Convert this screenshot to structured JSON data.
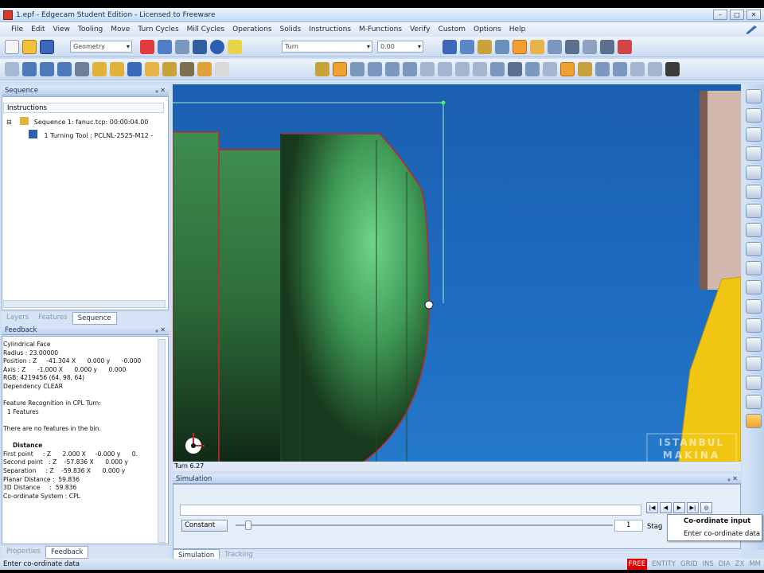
{
  "window": {
    "title": "1.epf - Edgecam Student Edition - Licensed to Freeware",
    "buttons": [
      "–",
      "□",
      "✕"
    ]
  },
  "menu": [
    "File",
    "Edit",
    "View",
    "Tooling",
    "Move",
    "Turn Cycles",
    "Mill Cycles",
    "Operations",
    "Solids",
    "Instructions",
    "M-Functions",
    "Verify",
    "Custom",
    "Options",
    "Help"
  ],
  "toolbar": {
    "geometry_combo": "Geometry",
    "turn_combo": "Turn",
    "value_combo": "0.00"
  },
  "sequence_panel": {
    "title": "Sequence",
    "instructions_header": "Instructions",
    "tree": {
      "sequence": "Sequence 1: fanuc.tcp: 00:00:04.00",
      "tool": "1 Turning Tool : PCLNL-2525-M12 -"
    },
    "tabs": [
      "Layers",
      "Features",
      "Sequence"
    ],
    "active_tab": "Sequence"
  },
  "feedback_panel": {
    "title": "Feedback",
    "lines": [
      "Cylindrical Face",
      "Radius : 23.00000",
      "Position : Z     -41.304 X      0.000 y      -0.000",
      "Axis : Z      -1.000 X      0.000 y      0.000",
      "RGB: 4219456 (64, 98, 64)",
      "Dependency CLEAR",
      "",
      "Feature Recognition in CPL Turn:",
      "  1 Features",
      "",
      "There are no features in the bin.",
      "",
      "Distance",
      "First point     : Z      2.000 X     -0.000 y      0.",
      "Second point   : Z    -57.836 X      0.000 y",
      "Separation     : Z    -59.836 X      0.000 y",
      "Planar Distance :  59.836",
      "3D Distance     :  59.836",
      "Co-ordinate System : CPL"
    ],
    "tabs": [
      "Properties",
      "Feedback"
    ],
    "active_tab": "Feedback"
  },
  "viewport": {
    "status": "Turn 6.27",
    "watermark_line1": "ISTANBUL",
    "watermark_line2": "MAKINA"
  },
  "simulation": {
    "title": "Simulation",
    "constant_label": "Constant",
    "spin_value": "1",
    "stage_label": "Stag",
    "controls": [
      "|◀",
      "◀",
      "▶",
      "▶|",
      "◎"
    ],
    "tabs": [
      "Simulation",
      "Tracking"
    ],
    "active_tab": "Simulation"
  },
  "popup_menu": {
    "items": [
      "Co-ordinate input",
      "Enter co-ordinate data"
    ]
  },
  "statusbar": {
    "message": "Enter co-ordinate data",
    "indicators": [
      "FREE",
      "ENTITY",
      "GRID",
      "INS",
      "DIA",
      "ZX",
      "MM"
    ]
  },
  "colors": {
    "viewport_blue": "#1d68bb",
    "part_green": "#2e7a3a",
    "part_edge": "#c0262a",
    "tool_yellow": "#f1c613"
  }
}
